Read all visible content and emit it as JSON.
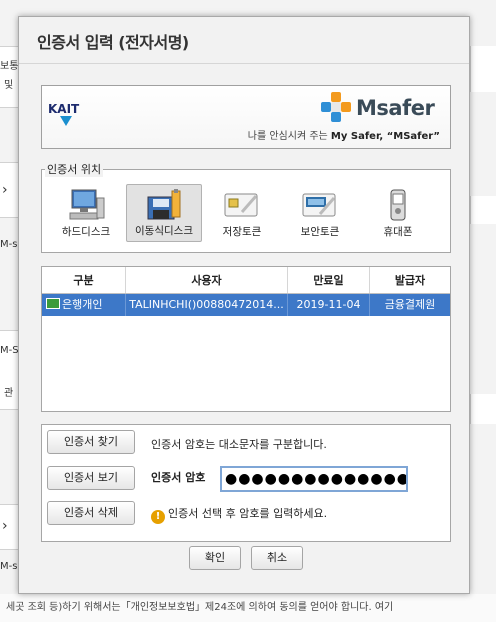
{
  "background": {
    "left_snippets": [
      "보통·",
      "및",
      "M-s",
      "M-S",
      "관",
      "M-s"
    ],
    "bottom_text": "세곳  조회 등)하기 위해서는「개인정보보호법」제24조에 의하여 동의를 얻어야 합니다. 여기"
  },
  "dialog": {
    "title": "인증서 입력 (전자서명)",
    "banner": {
      "kait_logo": "KAIT",
      "msafer_logo": "Msafer",
      "slogan_prefix": "나를 안심시켜 주는 ",
      "slogan_emphasis": "My Safer, “MSafer”"
    },
    "location": {
      "label": "인증서 위치",
      "items": [
        {
          "label": "하드디스크",
          "icon": "hard-disk-icon",
          "selected": false
        },
        {
          "label": "이동식디스크",
          "icon": "removable-disk-icon",
          "selected": true
        },
        {
          "label": "저장토큰",
          "icon": "storage-token-icon",
          "selected": false
        },
        {
          "label": "보안토큰",
          "icon": "security-token-icon",
          "selected": false
        },
        {
          "label": "휴대폰",
          "icon": "mobile-phone-icon",
          "selected": false
        }
      ]
    },
    "table": {
      "headers": [
        "구분",
        "사용자",
        "만료일",
        "발급자"
      ],
      "rows": [
        {
          "type": "은행개인",
          "user": "TALINHCHI()00880472014...",
          "expiry": "2019-11-04",
          "issuer": "금융결제원"
        }
      ]
    },
    "buttons": {
      "find": "인증서 찾기",
      "view": "인증서 보기",
      "delete": "인증서 삭제",
      "ok": "확인",
      "cancel": "취소"
    },
    "case_hint": "인증서 암호는 대소문자를 구분합니다.",
    "password": {
      "label": "인증서 암호",
      "value": "●●●●●●●●●●●●●●●"
    },
    "warning": "인증서 선택 후 암호를 입력하세요."
  }
}
